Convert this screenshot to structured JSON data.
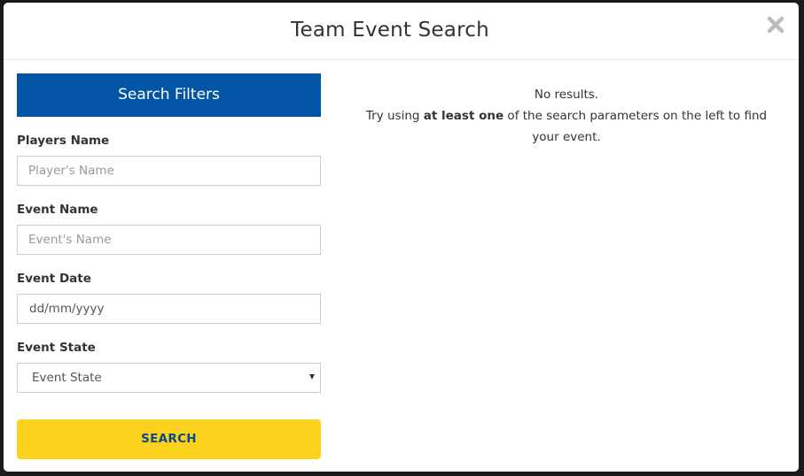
{
  "modal": {
    "title": "Team Event Search"
  },
  "filters": {
    "header": "Search Filters",
    "players_name": {
      "label": "Players Name",
      "placeholder": "Player's Name"
    },
    "event_name": {
      "label": "Event Name",
      "placeholder": "Event's Name"
    },
    "event_date": {
      "label": "Event Date",
      "placeholder": "dd/mm/yyyy"
    },
    "event_state": {
      "label": "Event State",
      "selected": "Event State"
    },
    "search_button": "SEARCH"
  },
  "results": {
    "no_results": "No results.",
    "hint_prefix": "Try using ",
    "hint_bold": "at least one",
    "hint_suffix": " of the search parameters on the left to find your event."
  },
  "icons": {
    "close": "close-icon",
    "select_arrow": "caret-down-icon"
  },
  "colors": {
    "filters_header_bg": "#0356a6",
    "search_button_bg": "#fbd11d",
    "search_button_text": "#0a4a8a"
  }
}
